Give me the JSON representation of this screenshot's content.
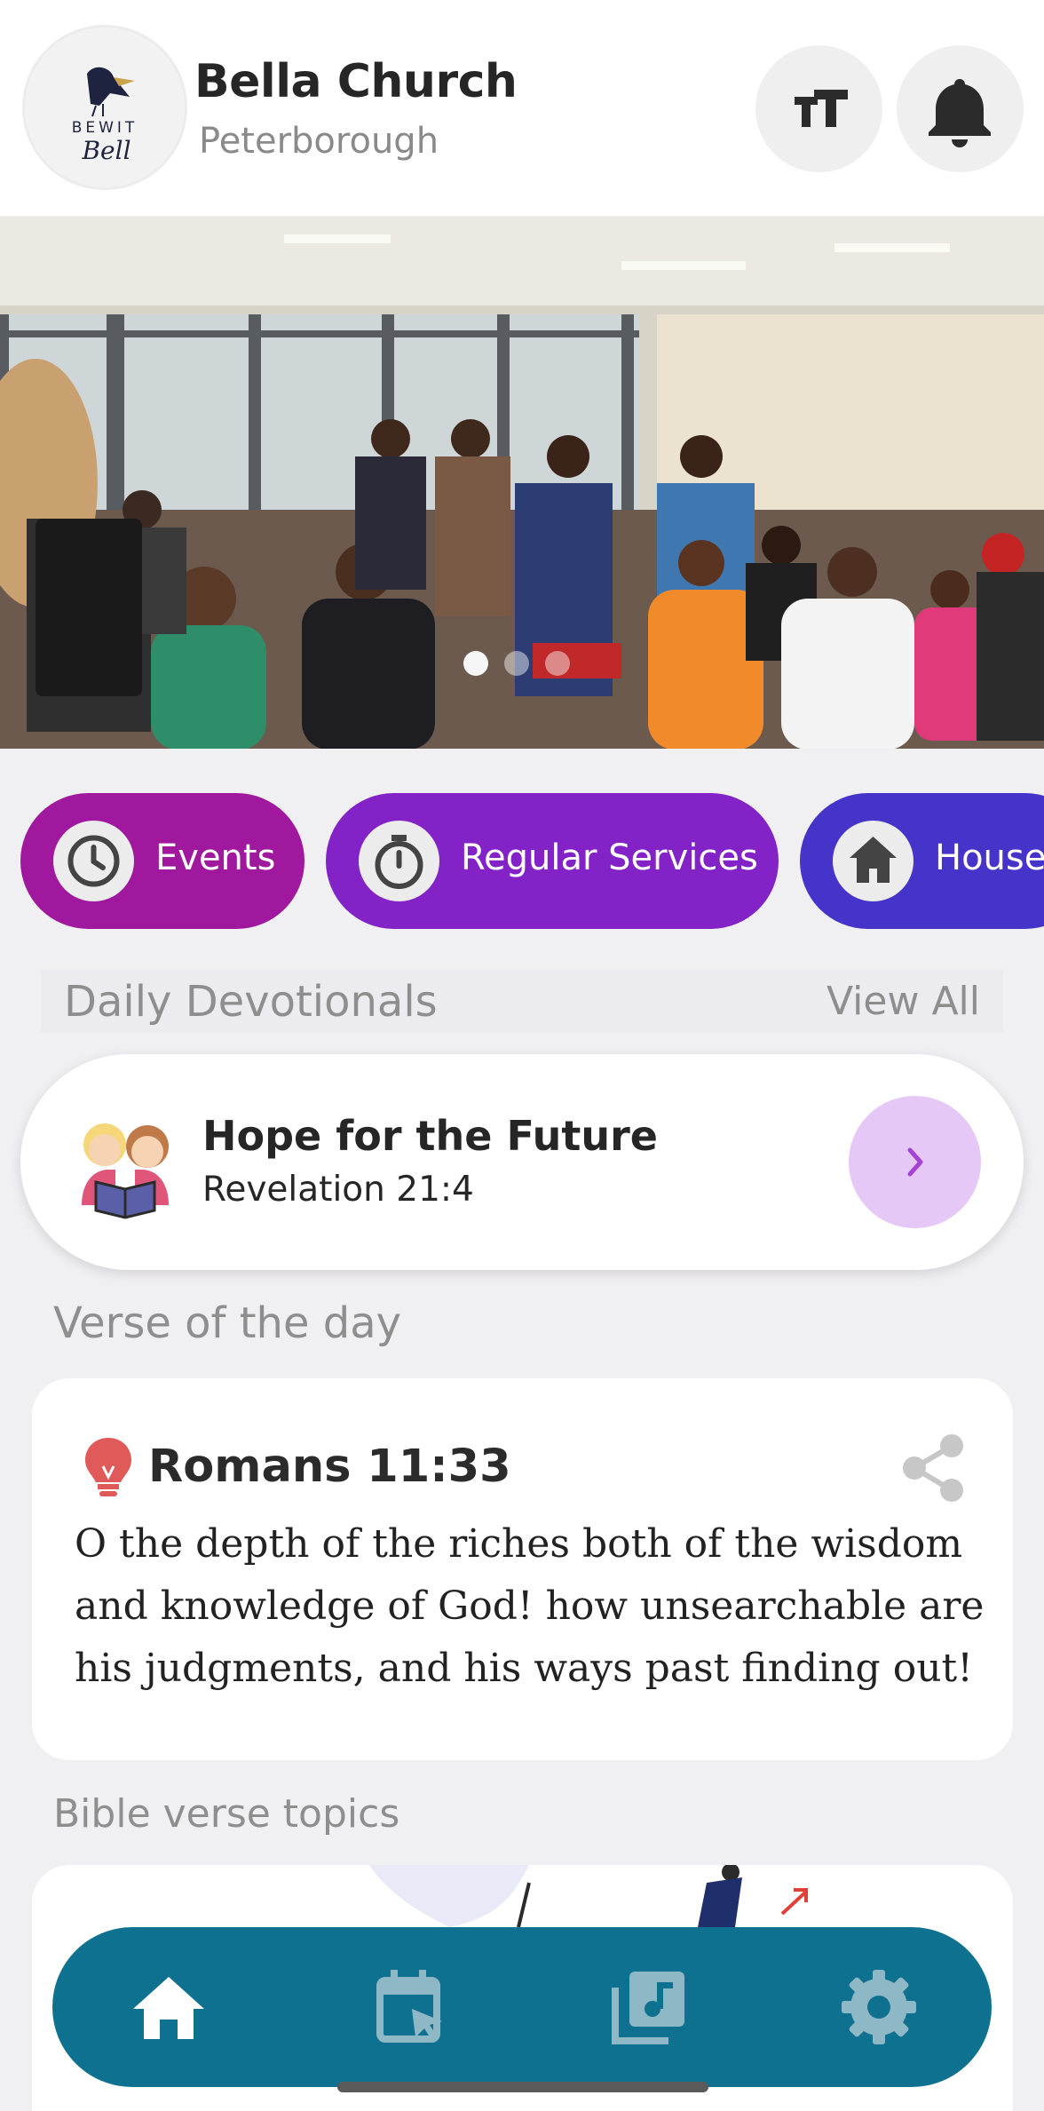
{
  "header": {
    "logo_text_top": "BEWIT",
    "logo_text_bottom": "Bell",
    "church_name": "Bella Church",
    "location": "Peterborough",
    "font_size_icon": "text-size-icon",
    "notifications_icon": "bell-icon"
  },
  "hero": {
    "slide_count": 3,
    "active_slide": 1
  },
  "categories": [
    {
      "label": "Events",
      "icon": "clock-icon",
      "color": "#a0189e"
    },
    {
      "label": "Regular Services",
      "icon": "stopwatch-icon",
      "color": "#8322c6"
    },
    {
      "label": "House",
      "icon": "house-icon",
      "color": "#4633c9"
    }
  ],
  "devotionals": {
    "section_title": "Daily Devotionals",
    "view_all": "View All",
    "item": {
      "title": "Hope for the Future",
      "reference": "Revelation 21:4"
    }
  },
  "verse_of_day": {
    "section_title": "Verse of the day",
    "reference": "Romans 11:33",
    "text": "O the depth of the riches both of the wisdom and knowledge of God! how unsearchable are his judgments, and his ways past finding out!"
  },
  "topics": {
    "section_title": "Bible verse topics"
  },
  "bottom_nav": {
    "items": [
      "home-icon",
      "calendar-icon",
      "media-library-icon",
      "settings-icon"
    ],
    "active": "home-icon",
    "color": "#0f7190"
  }
}
